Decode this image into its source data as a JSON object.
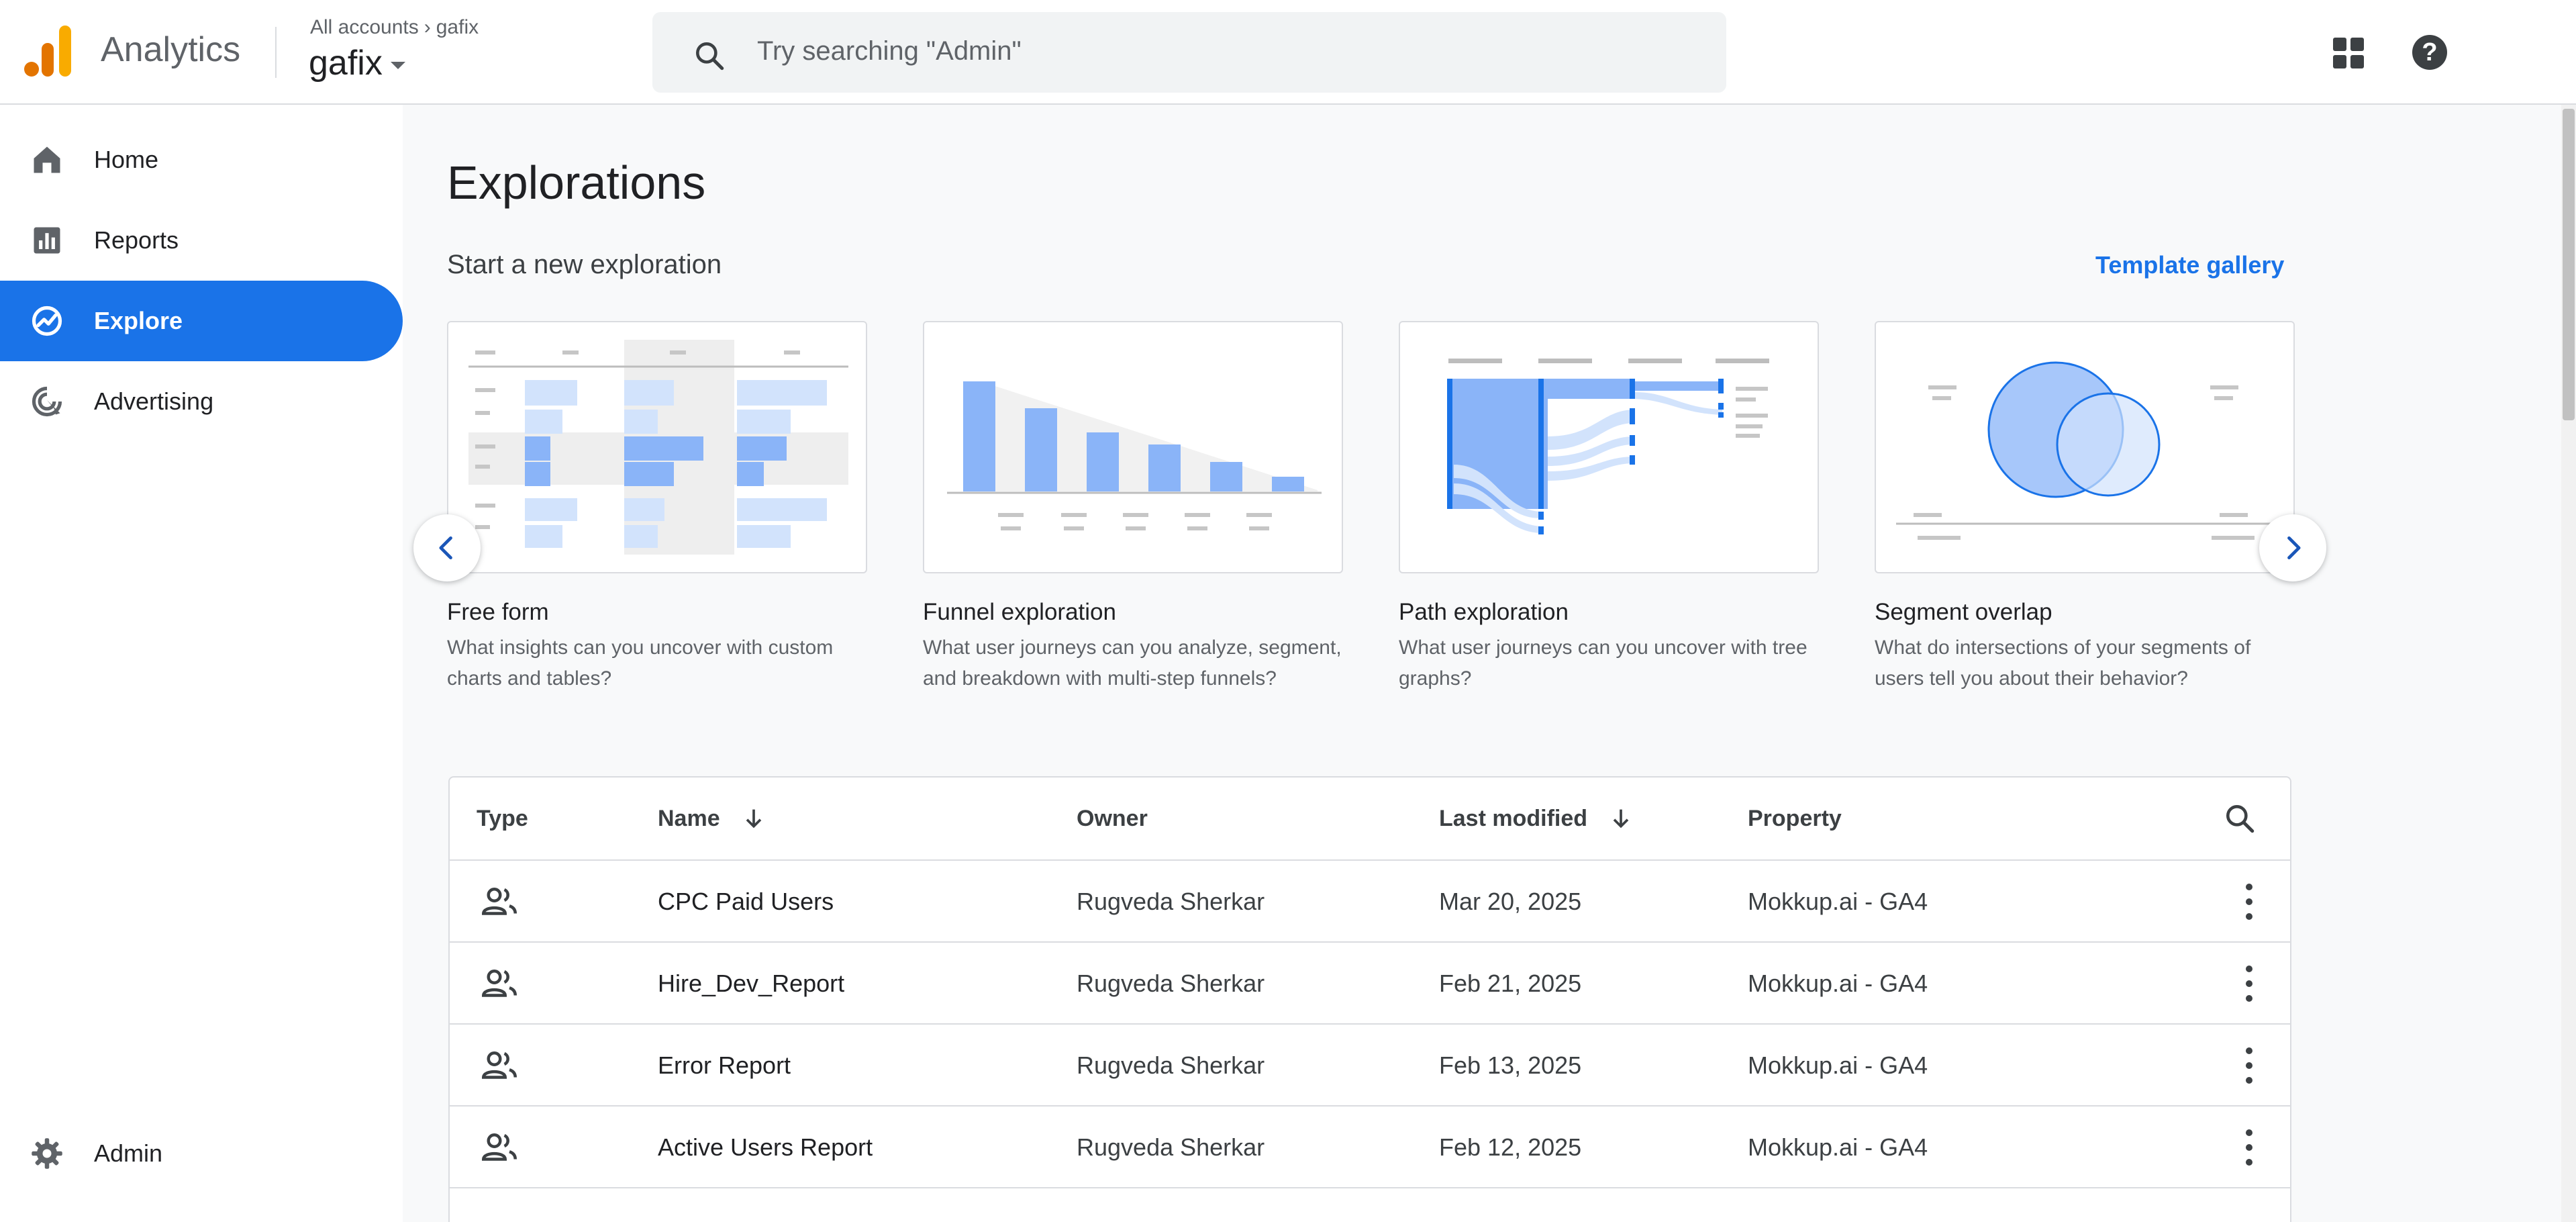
{
  "header": {
    "app_name": "Analytics",
    "breadcrumb_root": "All accounts",
    "breadcrumb_current": "gafix",
    "property_name": "gafix",
    "search_placeholder": "Try searching \"Admin\""
  },
  "sidebar": {
    "items": [
      {
        "label": "Home",
        "icon": "home-icon",
        "active": false
      },
      {
        "label": "Reports",
        "icon": "reports-icon",
        "active": false
      },
      {
        "label": "Explore",
        "icon": "explore-icon",
        "active": true
      },
      {
        "label": "Advertising",
        "icon": "advertising-icon",
        "active": false
      }
    ],
    "admin_label": "Admin"
  },
  "main": {
    "title": "Explorations",
    "section_title": "Start a new exploration",
    "template_gallery": "Template gallery",
    "cards": [
      {
        "title": "Free form",
        "desc": "What insights can you uncover with custom charts and tables?"
      },
      {
        "title": "Funnel exploration",
        "desc": "What user journeys can you analyze, segment, and breakdown with multi-step funnels?"
      },
      {
        "title": "Path exploration",
        "desc": "What user journeys can you uncover with tree graphs?"
      },
      {
        "title": "Segment overlap",
        "desc": "What do intersections of your segments of users tell you about their behavior?"
      }
    ]
  },
  "table": {
    "columns": {
      "type": "Type",
      "name": "Name",
      "owner": "Owner",
      "last_modified": "Last modified",
      "property": "Property"
    },
    "rows": [
      {
        "name": "CPC Paid Users",
        "owner": "Rugveda Sherkar",
        "modified": "Mar 20, 2025",
        "property": "Mokkup.ai - GA4"
      },
      {
        "name": "Hire_Dev_Report",
        "owner": "Rugveda Sherkar",
        "modified": "Feb 21, 2025",
        "property": "Mokkup.ai - GA4"
      },
      {
        "name": "Error Report",
        "owner": "Rugveda Sherkar",
        "modified": "Feb 13, 2025",
        "property": "Mokkup.ai - GA4"
      },
      {
        "name": "Active Users Report",
        "owner": "Rugveda Sherkar",
        "modified": "Feb 12, 2025",
        "property": "Mokkup.ai - GA4"
      }
    ]
  },
  "colors": {
    "accent": "#1a73e8",
    "chart_blue": "#8ab4f8",
    "logo_orange": "#e37400",
    "logo_yellow": "#f9ab00"
  }
}
